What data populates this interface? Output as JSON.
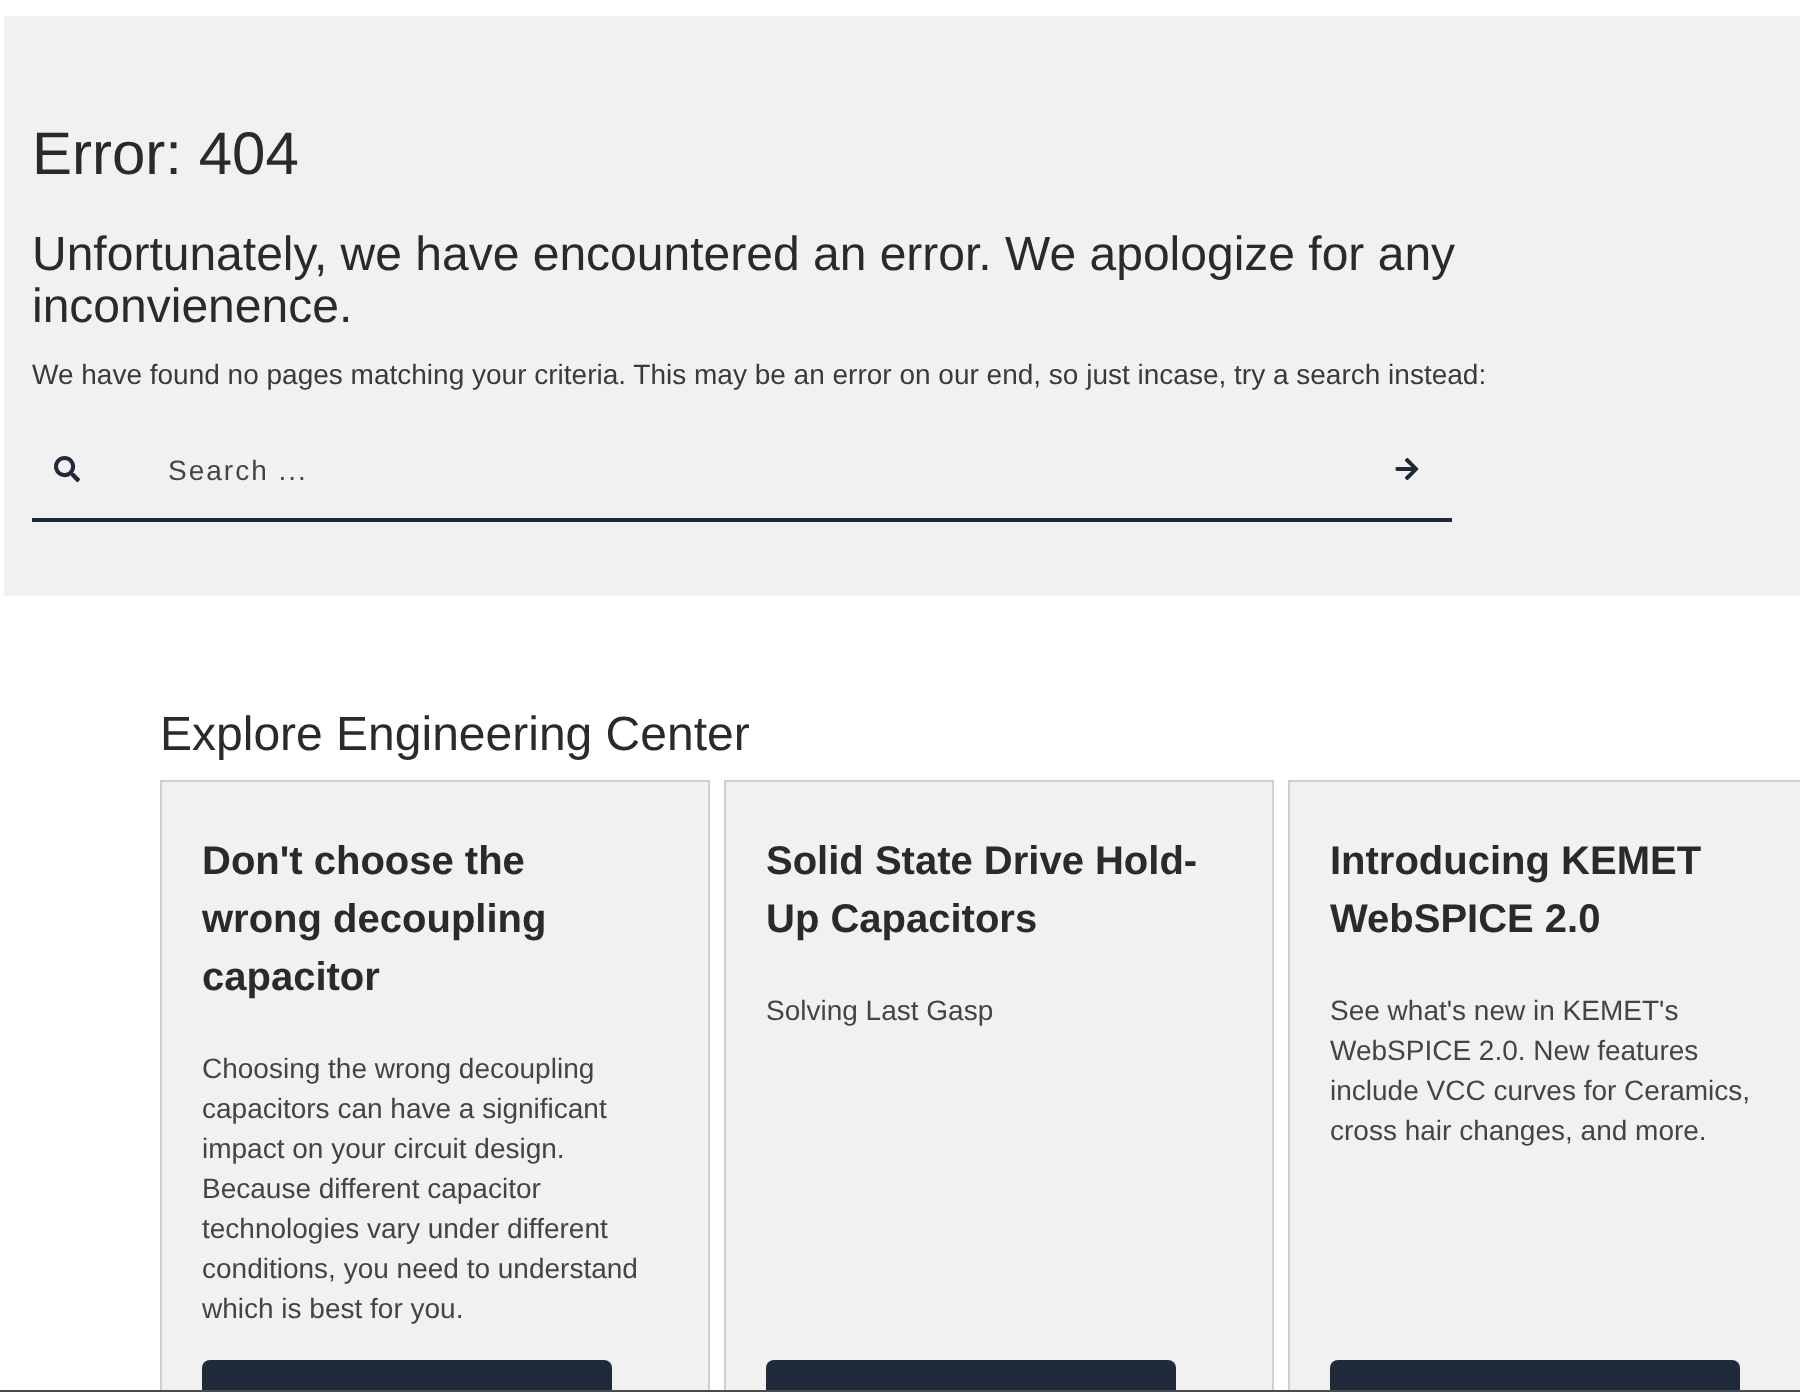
{
  "error": {
    "title": "Error: 404",
    "subtitle": "Unfortunately, we have encountered an error. We apologize for any inconvienence.",
    "message": "We have found no pages matching your criteria. This may be an error on our end, so just incase, try a search instead:"
  },
  "search": {
    "placeholder": "Search ..."
  },
  "explore": {
    "heading": "Explore Engineering Center",
    "cards": [
      {
        "title": "Don't choose the wrong decoupling capacitor",
        "description": "Choosing the wrong decoupling capacitors can have a significant impact on your circuit design. Because different capacitor technologies vary under different conditions, you need to understand which is best for you."
      },
      {
        "title": "Solid State Drive Hold-Up Capacitors",
        "description": "Solving Last Gasp"
      },
      {
        "title": "Introducing KEMET WebSPICE 2.0",
        "description": "See what's new in KEMET's WebSPICE 2.0. New features include VCC curves for Ceramics, cross hair changes, and more."
      }
    ]
  }
}
